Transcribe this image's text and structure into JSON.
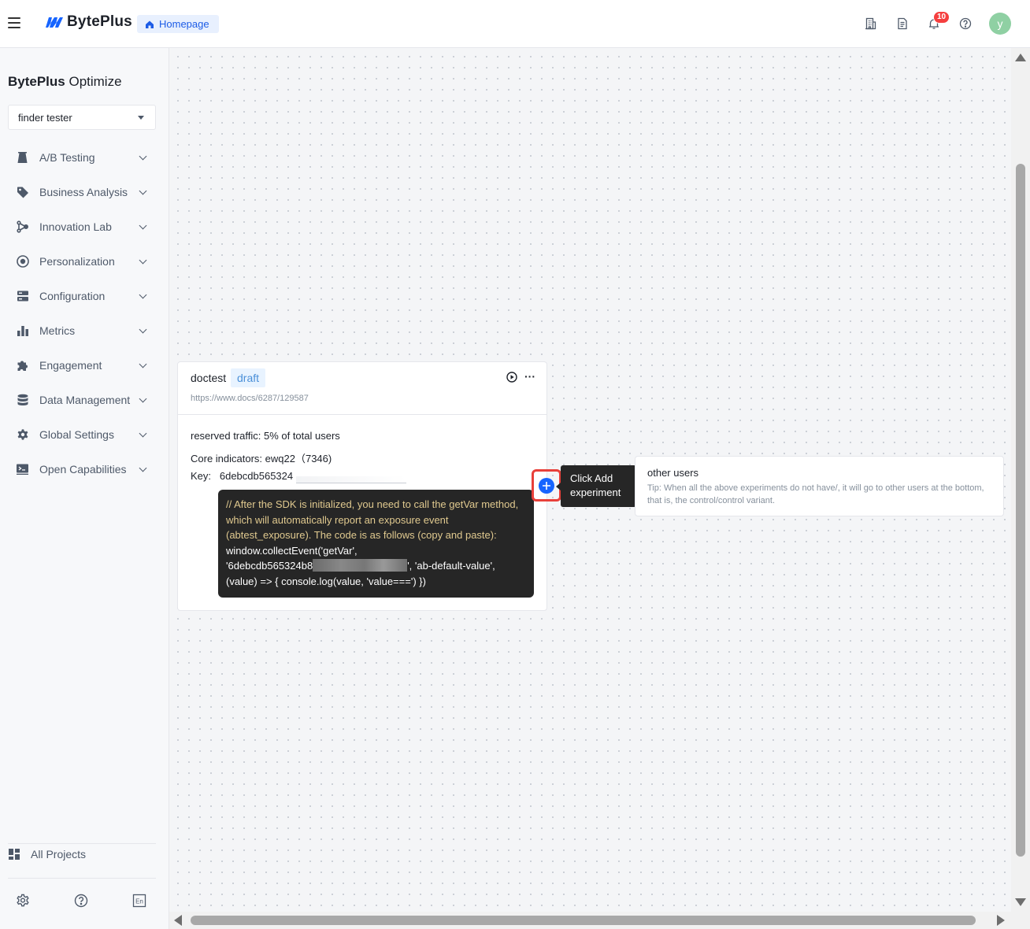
{
  "header": {
    "brand": "BytePlus",
    "home_chip": "Homepage",
    "notification_count": "10",
    "avatar_letter": "y",
    "icons": [
      "building-icon",
      "document-icon",
      "bell-icon",
      "help-icon"
    ]
  },
  "sidebar": {
    "product_name_bold": "BytePlus",
    "product_name_rest": " Optimize",
    "project_select": "finder tester",
    "items": [
      {
        "label": "A/B Testing",
        "icon": "flask-icon"
      },
      {
        "label": "Business Analysis",
        "icon": "tag-icon"
      },
      {
        "label": "Innovation Lab",
        "icon": "branch-icon"
      },
      {
        "label": "Personalization",
        "icon": "target-icon"
      },
      {
        "label": "Configuration",
        "icon": "server-icon"
      },
      {
        "label": "Metrics",
        "icon": "bar-chart-icon"
      },
      {
        "label": "Engagement",
        "icon": "puzzle-icon"
      },
      {
        "label": "Data Management",
        "icon": "database-icon"
      },
      {
        "label": "Global Settings",
        "icon": "gear-icon"
      },
      {
        "label": "Open Capabilities",
        "icon": "terminal-icon"
      }
    ],
    "all_projects": "All Projects",
    "footer_icons": [
      "settings-icon",
      "help-icon",
      "language-icon"
    ],
    "language_label": "En"
  },
  "experiment": {
    "name": "doctest",
    "status": "draft",
    "url": "https://www.docs/6287/129587",
    "traffic": "reserved traffic: 5% of total users",
    "core_indicators": "Core indicators: ewq22（7346)",
    "key_label": "Key:",
    "key_value": "6debcdb565324",
    "code_comment": "// After the SDK is initialized, you need to call the getVar method, which will automatically report an exposure event (abtest_exposure). The code is as follows (copy and paste):",
    "code_line1": "window.collectEvent('getVar',",
    "code_line2_prefix": "'6debcdb565324b8",
    "code_line2_suffix": "', 'ab-default-value',",
    "code_line3": "(value) => { console.log(value, 'value===') })"
  },
  "add_tooltip": {
    "line1": "Click Add",
    "line2": "experiment"
  },
  "other_users": {
    "title": "other users",
    "tip": "Tip:  When all the above experiments do not have/, it will go to other users at the bottom, that is, the control/control variant."
  },
  "colors": {
    "accent": "#1664ff",
    "highlight_border": "#e8403a",
    "badge": "#f53f3f"
  }
}
